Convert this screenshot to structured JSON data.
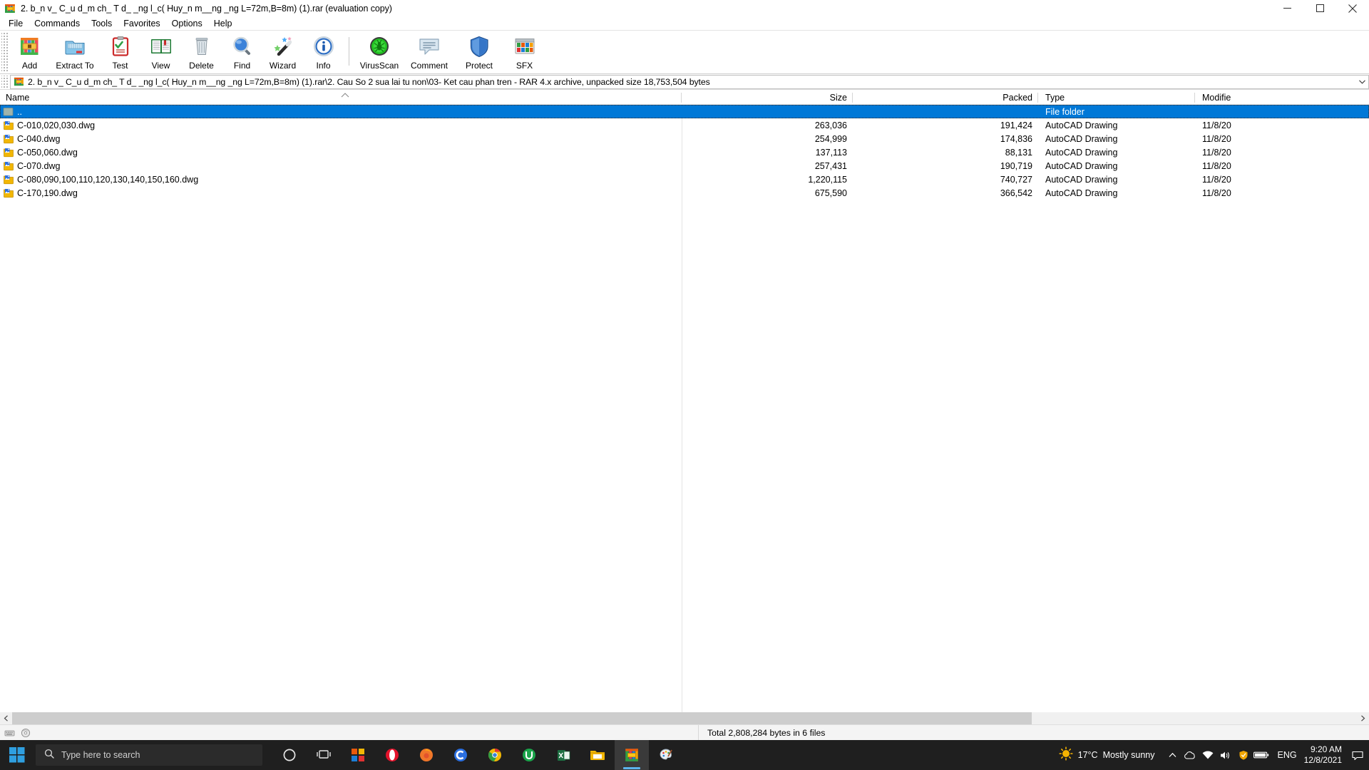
{
  "window": {
    "title": "2. b_n v_ C_u d_m ch_ T d_ _ng l_c( Huy_n m__ng _ng L=72m,B=8m) (1).rar (evaluation copy)",
    "app_icon": "winrar-icon",
    "buttons": {
      "minimize": "minimize-button",
      "maximize": "maximize-button",
      "close": "close-button"
    }
  },
  "menubar": {
    "items": [
      {
        "label": "File"
      },
      {
        "label": "Commands"
      },
      {
        "label": "Tools"
      },
      {
        "label": "Favorites"
      },
      {
        "label": "Options"
      },
      {
        "label": "Help"
      }
    ]
  },
  "toolbar": {
    "buttons": [
      {
        "label": "Add",
        "icon": "add-archive-icon"
      },
      {
        "label": "Extract To",
        "icon": "extract-folder-icon"
      },
      {
        "label": "Test",
        "icon": "test-clipboard-icon"
      },
      {
        "label": "View",
        "icon": "view-book-icon"
      },
      {
        "label": "Delete",
        "icon": "delete-trash-icon"
      },
      {
        "label": "Find",
        "icon": "find-magnifier-icon"
      },
      {
        "label": "Wizard",
        "icon": "wizard-wand-icon"
      },
      {
        "label": "Info",
        "icon": "info-circle-icon"
      }
    ],
    "buttons_after_separator": [
      {
        "label": "VirusScan",
        "icon": "virusscan-bug-icon"
      },
      {
        "label": "Comment",
        "icon": "comment-bubble-icon"
      },
      {
        "label": "Protect",
        "icon": "protect-shield-icon"
      },
      {
        "label": "SFX",
        "icon": "sfx-box-icon"
      }
    ]
  },
  "address": {
    "icon": "winrar-icon",
    "path": "2. b_n v_ C_u d_m ch_ T d_ _ng l_c( Huy_n m__ng _ng L=72m,B=8m) (1).rar\\2. Cau So 2 sua lai tu non\\03- Ket cau phan tren - RAR 4.x archive, unpacked size 18,753,504 bytes",
    "dropdown_icon": "chevron-down-icon"
  },
  "list": {
    "columns": [
      {
        "key": "name",
        "label": "Name",
        "sorted": true,
        "sort_dir": "asc"
      },
      {
        "key": "size",
        "label": "Size"
      },
      {
        "key": "packed",
        "label": "Packed"
      },
      {
        "key": "type",
        "label": "Type"
      },
      {
        "key": "mod",
        "label": "Modifie"
      }
    ],
    "rows": [
      {
        "name": "..",
        "size": "",
        "packed": "",
        "type": "File folder",
        "mod": "",
        "icon": "folder-up-icon",
        "selected": true
      },
      {
        "name": "C-010,020,030.dwg",
        "size": "263,036",
        "packed": "191,424",
        "type": "AutoCAD Drawing",
        "mod": "11/8/20",
        "icon": "dwg-file-icon",
        "selected": false
      },
      {
        "name": "C-040.dwg",
        "size": "254,999",
        "packed": "174,836",
        "type": "AutoCAD Drawing",
        "mod": "11/8/20",
        "icon": "dwg-file-icon",
        "selected": false
      },
      {
        "name": "C-050,060.dwg",
        "size": "137,113",
        "packed": "88,131",
        "type": "AutoCAD Drawing",
        "mod": "11/8/20",
        "icon": "dwg-file-icon",
        "selected": false
      },
      {
        "name": "C-070.dwg",
        "size": "257,431",
        "packed": "190,719",
        "type": "AutoCAD Drawing",
        "mod": "11/8/20",
        "icon": "dwg-file-icon",
        "selected": false
      },
      {
        "name": "C-080,090,100,110,120,130,140,150,160.dwg",
        "size": "1,220,115",
        "packed": "740,727",
        "type": "AutoCAD Drawing",
        "mod": "11/8/20",
        "icon": "dwg-file-icon",
        "selected": false
      },
      {
        "name": "C-170,190.dwg",
        "size": "675,590",
        "packed": "366,542",
        "type": "AutoCAD Drawing",
        "mod": "11/8/20",
        "icon": "dwg-file-icon",
        "selected": false
      }
    ]
  },
  "statusbar": {
    "left_icons": [
      "key-icon",
      "disc-icon"
    ],
    "total_text": "Total 2,808,284 bytes in 6 files"
  },
  "taskbar": {
    "start": "windows-start-icon",
    "search_placeholder": "Type here to search",
    "search_icon": "search-icon",
    "pinned": [
      {
        "name": "cortana-icon"
      },
      {
        "name": "task-view-icon"
      },
      {
        "name": "widgets-icon"
      },
      {
        "name": "opera-icon"
      },
      {
        "name": "firefox-icon"
      },
      {
        "name": "coccoc-icon"
      },
      {
        "name": "chrome-icon"
      },
      {
        "name": "unikey-icon"
      },
      {
        "name": "excel-icon"
      },
      {
        "name": "file-explorer-icon"
      },
      {
        "name": "winrar-icon"
      },
      {
        "name": "paint-icon"
      }
    ],
    "tray": {
      "weather_temp": "17°C",
      "weather_desc": "Mostly sunny",
      "weather_icon": "sun-icon",
      "chevron": "show-hidden-icons-chevron",
      "icons": [
        "onedrive-icon",
        "network-icon",
        "volume-icon",
        "shield-icon",
        "battery-icon"
      ],
      "language": "ENG",
      "time": "9:20 AM",
      "date": "12/8/2021",
      "notifications": "notification-center-icon"
    }
  },
  "colors": {
    "selection_blue": "#0078d7",
    "taskbar_bg": "#1f1f1f",
    "window_bg": "#ffffff",
    "statusbar_bg": "#f4f4f4"
  }
}
